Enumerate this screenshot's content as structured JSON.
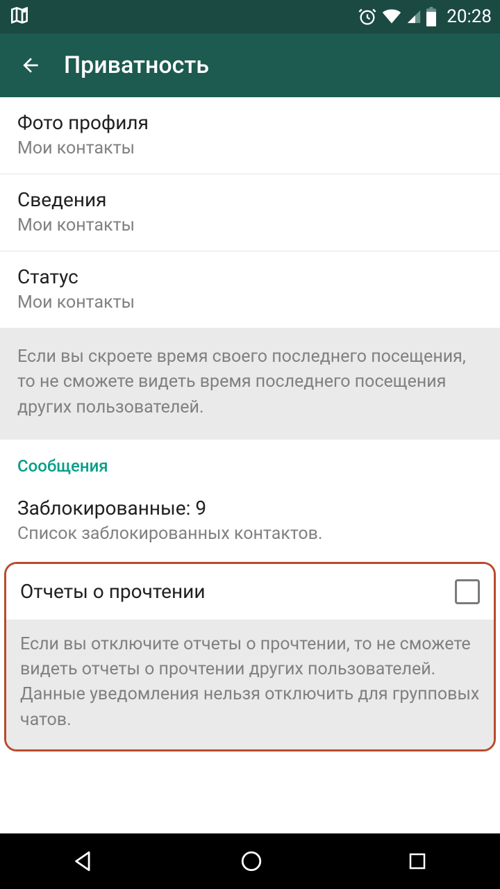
{
  "status": {
    "time": "20:28"
  },
  "header": {
    "title": "Приватность"
  },
  "items": {
    "profile_photo": {
      "title": "Фото профиля",
      "sub": "Мои контакты"
    },
    "about": {
      "title": "Сведения",
      "sub": "Мои контакты"
    },
    "status": {
      "title": "Статус",
      "sub": "Мои контакты"
    }
  },
  "last_seen_note": "Если вы скроете время своего последнего посещения, то не сможете видеть время последнего посещения других пользователей.",
  "section_messages": "Сообщения",
  "blocked": {
    "title": "Заблокированные: 9",
    "sub": "Список заблокированных контактов."
  },
  "read_receipts": {
    "label": "Отчеты о прочтении",
    "note": "Если вы отключите отчеты о прочтении, то не сможете видеть отчеты о прочтении других пользователей. Данные уведомления нельзя отключить для групповых чатов."
  }
}
